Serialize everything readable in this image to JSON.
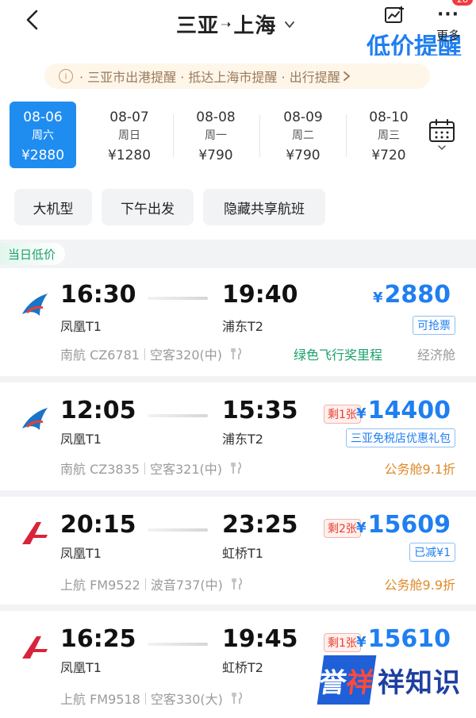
{
  "header": {
    "origin": "三亚",
    "dest": "上海",
    "price_alert_label": "低价提醒",
    "more_label": "更多",
    "badge_count": "28"
  },
  "notice": {
    "text": "· 三亚市出港提醒 · 抵达上海市提醒 · 出行提醒"
  },
  "dates": [
    {
      "date": "08-06",
      "weekday": "周六",
      "price": "¥2880",
      "selected": true
    },
    {
      "date": "08-07",
      "weekday": "周日",
      "price": "¥1280"
    },
    {
      "date": "08-08",
      "weekday": "周一",
      "price": "¥790"
    },
    {
      "date": "08-09",
      "weekday": "周二",
      "price": "¥790"
    },
    {
      "date": "08-10",
      "weekday": "周三",
      "price": "¥720"
    }
  ],
  "filters": [
    "大机型",
    "下午出发",
    "隐藏共享航班"
  ],
  "section_label": "当日低价",
  "flights": [
    {
      "dep_time": "16:30",
      "arr_time": "19:40",
      "dep_airport": "凤凰T1",
      "arr_airport": "浦东T2",
      "airline": "南航 CZ6781",
      "aircraft": "空客320(中)",
      "price": "2880",
      "currency": "¥",
      "tag": "可抢票",
      "promo": "绿色飞行奖里程",
      "cabin": "经济舱",
      "logo": "china-southern",
      "cabin_color": "#999999"
    },
    {
      "dep_time": "12:05",
      "arr_time": "15:35",
      "dep_airport": "凤凰T1",
      "arr_airport": "浦东T2",
      "airline": "南航 CZ3835",
      "aircraft": "空客321(中)",
      "price": "14400",
      "currency": "¥",
      "remain": "剩1张",
      "tag": "三亚免税店优惠礼包",
      "cabin": "公务舱9.1折",
      "logo": "china-southern",
      "cabin_color": "#e08a2a"
    },
    {
      "dep_time": "20:15",
      "arr_time": "23:25",
      "dep_airport": "凤凰T1",
      "arr_airport": "虹桥T1",
      "airline": "上航 FM9522",
      "aircraft": "波音737(中)",
      "price": "15609",
      "currency": "¥",
      "remain": "剩2张",
      "tag": "已减¥1",
      "cabin": "公务舱9.9折",
      "logo": "shanghai-airlines",
      "cabin_color": "#e08a2a"
    },
    {
      "dep_time": "16:25",
      "arr_time": "19:45",
      "dep_airport": "凤凰T1",
      "arr_airport": "虹桥T2",
      "airline": "上航 FM9518",
      "aircraft": "空客330(大)",
      "price": "15610",
      "currency": "¥",
      "remain": "剩1张",
      "logo": "shanghai-airlines"
    }
  ],
  "watermark": {
    "box_text_a": "誉",
    "box_text_b": "祥",
    "text": "祥知识"
  },
  "colors": {
    "accent": "#1f8cf0",
    "price": "#1f7ff0",
    "green": "#1aa06a",
    "orange": "#e08a2a",
    "red": "#e8402f"
  }
}
